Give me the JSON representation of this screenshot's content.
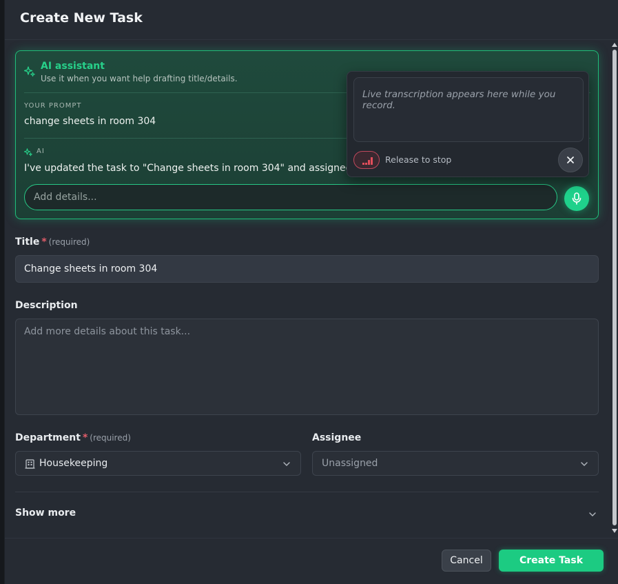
{
  "modal": {
    "title": "Create New Task"
  },
  "ai_assistant": {
    "title": "AI assistant",
    "subtitle": "Use it when you want help drafting title/details.",
    "prompt_label": "YOUR PROMPT",
    "prompt_text": "change sheets in room 304",
    "ai_label": "AI",
    "ai_response": "I've updated the task to \"Change sheets in room 304\" and assigned it to",
    "input_placeholder": "Add details...",
    "accent_color": "#1fd18b"
  },
  "transcription": {
    "placeholder": "Live transcription appears here while you record.",
    "status": "Release to stop"
  },
  "form": {
    "title_label": "Title",
    "required_star": "*",
    "required_text": "(required)",
    "title_value": "Change sheets in room 304",
    "description_label": "Description",
    "description_placeholder": "Add more details about this task...",
    "department_label": "Department",
    "department_value": "Housekeeping",
    "assignee_label": "Assignee",
    "assignee_value": "Unassigned",
    "show_more": "Show more"
  },
  "footer": {
    "cancel": "Cancel",
    "create": "Create Task"
  }
}
